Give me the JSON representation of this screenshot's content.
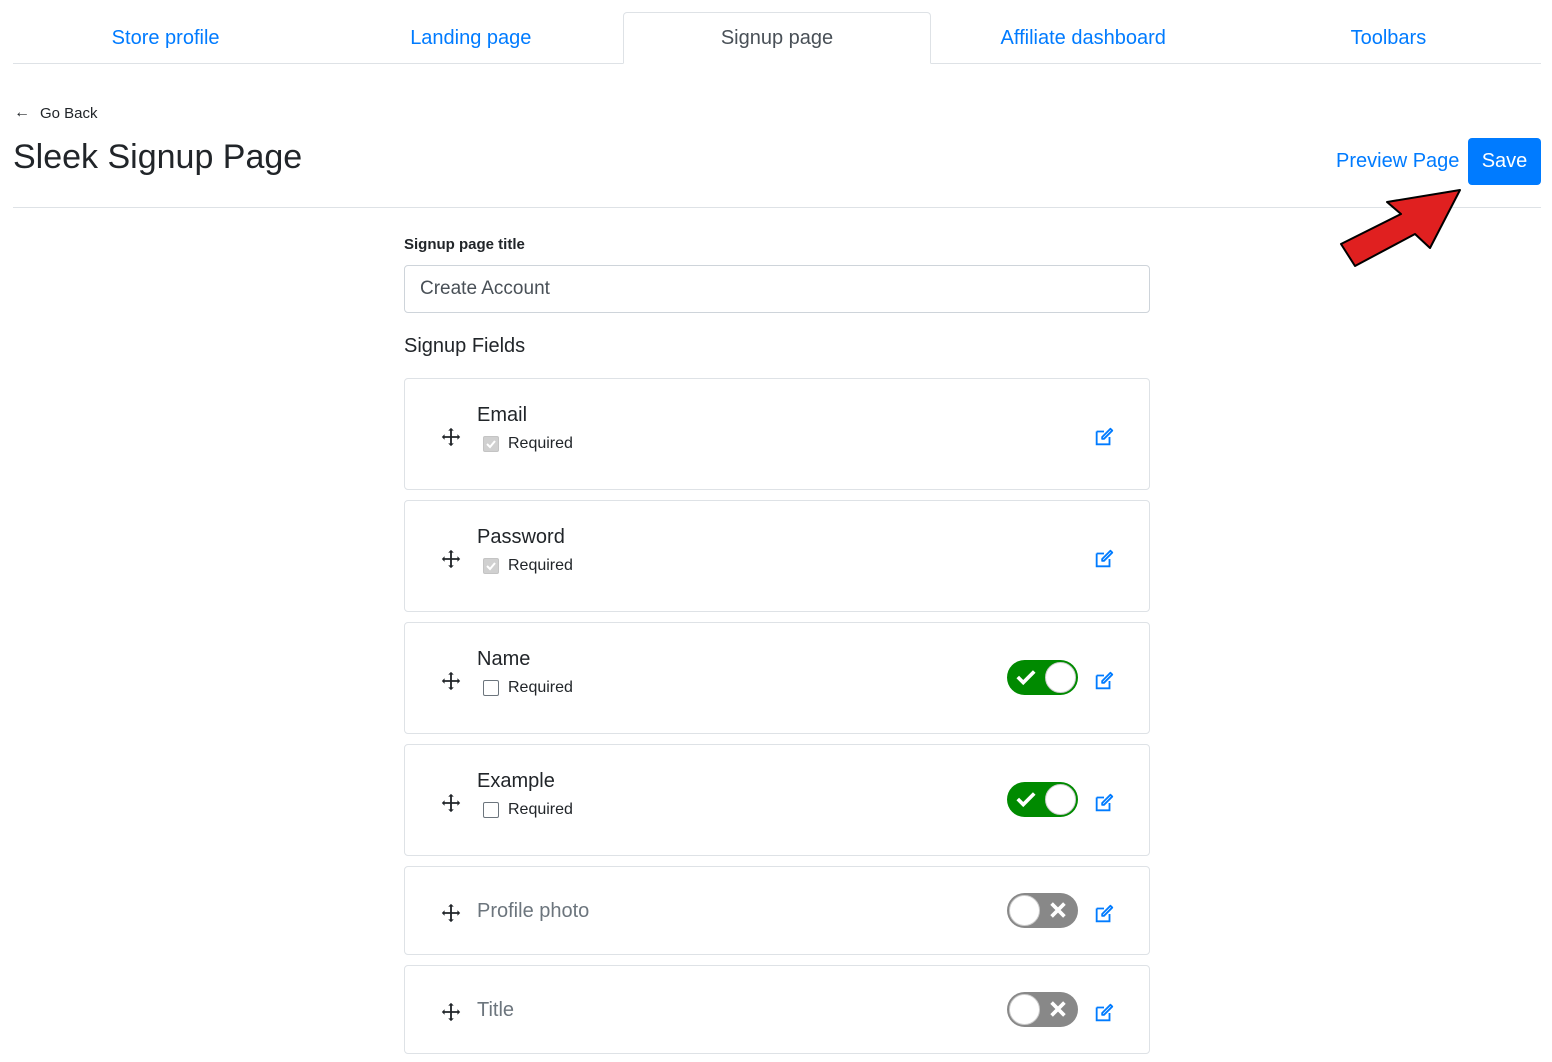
{
  "tabs": [
    {
      "label": "Store profile"
    },
    {
      "label": "Landing page"
    },
    {
      "label": "Signup page"
    },
    {
      "label": "Affiliate dashboard"
    },
    {
      "label": "Toolbars"
    }
  ],
  "header": {
    "go_back": "Go Back",
    "title": "Sleek Signup Page",
    "preview": "Preview Page",
    "save": "Save"
  },
  "form": {
    "title_label": "Signup page title",
    "title_value": "Create Account",
    "fields_label": "Signup Fields",
    "fields": [
      {
        "name": "Email",
        "required_label": "Required",
        "required": true,
        "locked": true,
        "enabled": null
      },
      {
        "name": "Password",
        "required_label": "Required",
        "required": true,
        "locked": true,
        "enabled": null
      },
      {
        "name": "Name",
        "required_label": "Required",
        "required": false,
        "locked": false,
        "enabled": true
      },
      {
        "name": "Example",
        "required_label": "Required",
        "required": false,
        "locked": false,
        "enabled": true
      },
      {
        "name": "Profile photo",
        "enabled": false
      },
      {
        "name": "Title",
        "enabled": false
      }
    ]
  },
  "colors": {
    "accent": "#007bff",
    "toggle_on": "#008a00",
    "toggle_off": "#888888",
    "annotation_arrow": "#e02020"
  }
}
